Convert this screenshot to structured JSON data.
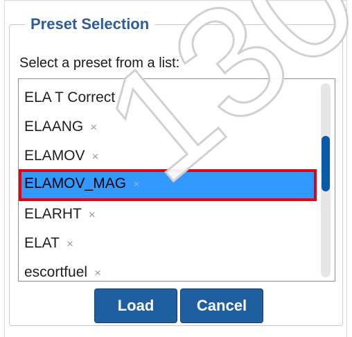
{
  "group": {
    "legend": "Preset Selection"
  },
  "prompt": "Select a preset from a list:",
  "list": {
    "items": [
      {
        "label": "ELA T Correct",
        "remove_glyph": "×"
      },
      {
        "label": "ELAANG",
        "remove_glyph": "×"
      },
      {
        "label": "ELAMOV",
        "remove_glyph": "×"
      },
      {
        "label": "ELAMOV_MAG",
        "remove_glyph": "×"
      },
      {
        "label": "ELARHT",
        "remove_glyph": "×"
      },
      {
        "label": "ELAT",
        "remove_glyph": "×"
      },
      {
        "label": "escortfuel",
        "remove_glyph": "×"
      }
    ],
    "selected_index": 3
  },
  "buttons": {
    "load": "Load",
    "cancel": "Cancel"
  },
  "watermark_text": "130.",
  "colors": {
    "accent": "#1f5f9f",
    "legend": "#2e5b9a",
    "selection": "#3399ff",
    "highlight_border": "#e3000f",
    "scroll_thumb": "#0b5aa8"
  }
}
